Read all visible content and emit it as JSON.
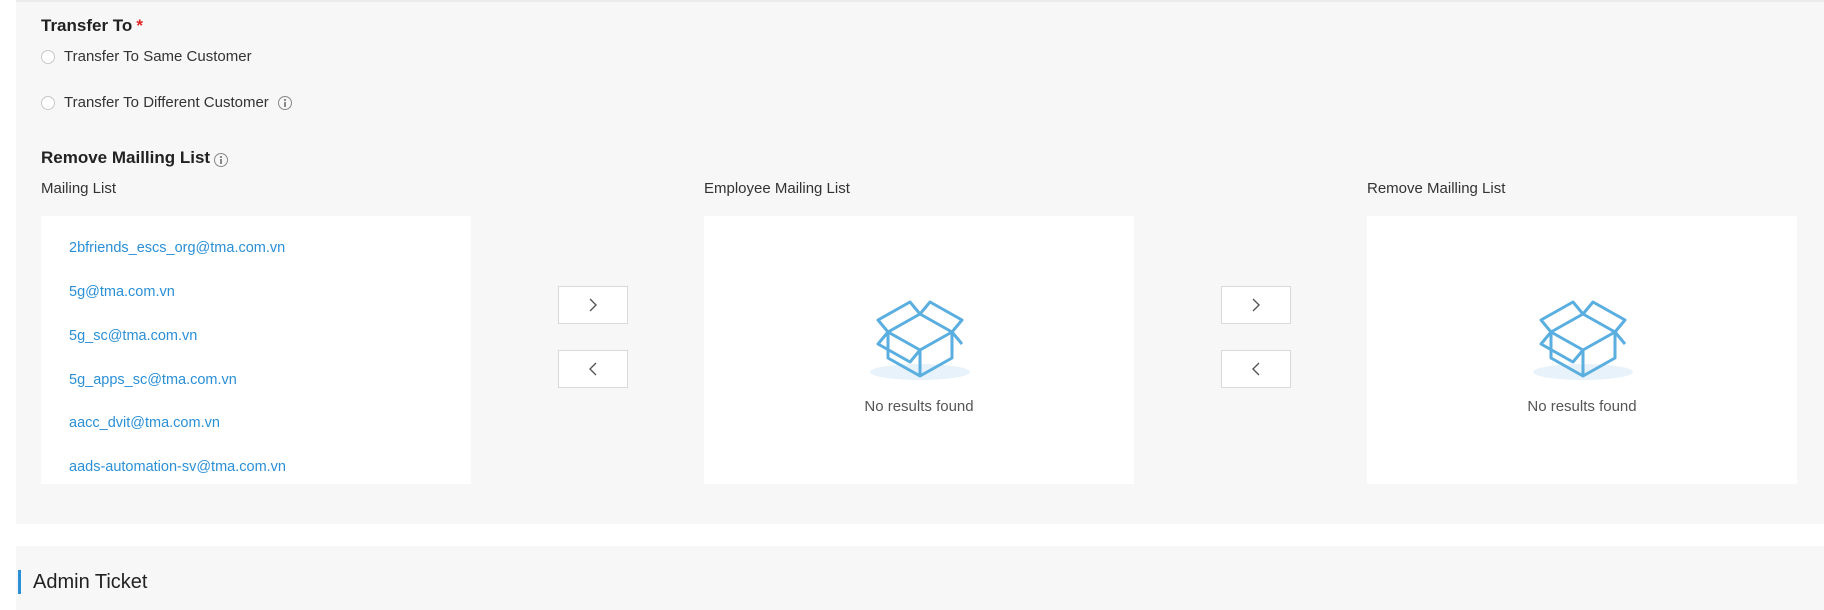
{
  "transfer": {
    "title": "Transfer To",
    "required_mark": "*",
    "option_same": "Transfer To Same Customer",
    "option_different": "Transfer To Different Customer"
  },
  "remove_section": {
    "title": "Remove Mailling List"
  },
  "columns": {
    "mailing_list": "Mailing List",
    "employee_mailing_list": "Employee Mailing List",
    "remove_mailing_list": "Remove Mailling List"
  },
  "mailing_items": [
    "2bfriends_escs_org@tma.com.vn",
    "5g@tma.com.vn",
    "5g_sc@tma.com.vn",
    "5g_apps_sc@tma.com.vn",
    "aacc_dvit@tma.com.vn",
    "aads-automation-sv@tma.com.vn"
  ],
  "empty_state": {
    "employee": "No results found",
    "remove": "No results found"
  },
  "admin": {
    "title": "Admin Ticket"
  },
  "icons": {
    "move_right": "chevron-right-icon",
    "move_left": "chevron-left-icon",
    "empty": "empty-box-icon",
    "info": "info-icon"
  },
  "colors": {
    "link": "#2b8fd6",
    "required": "#e02424",
    "empty_icon": "#5aaee0"
  }
}
